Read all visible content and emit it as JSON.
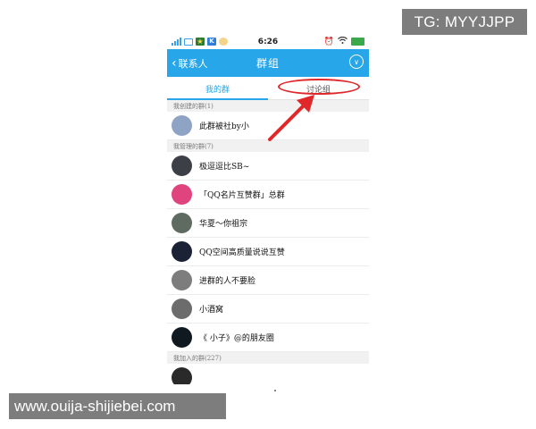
{
  "watermarks": {
    "top": "TG: MYYJJPP",
    "bottom": "www.ouija-shijiebei.com"
  },
  "status_bar": {
    "time": "6:26"
  },
  "title_bar": {
    "back_label": "联系人",
    "title": "群组"
  },
  "tabs": [
    {
      "label": "我的群",
      "active": true
    },
    {
      "label": "讨论组",
      "active": false
    }
  ],
  "sections": {
    "created": "我创建的群(1)",
    "managed": "我管理的群(7)",
    "joined": "我加入的群(227)"
  },
  "groups": {
    "created": [
      {
        "name": "此群被社by小",
        "avatar_color": "#8fa3c4"
      }
    ],
    "managed": [
      {
        "name": "极逗逗比SB~",
        "avatar_color": "#3c3f46"
      },
      {
        "name": "「QQ名片互赞群」总群",
        "avatar_color": "#e0447f"
      },
      {
        "name": "华夏～你祖宗",
        "avatar_color": "#5f6a61"
      },
      {
        "name": "QQ空间高质量说说互赞",
        "avatar_color": "#1c2235"
      },
      {
        "name": "进群的人不要脸",
        "avatar_color": "#7d7d7d"
      },
      {
        "name": "小酒窝",
        "avatar_color": "#6c6c6c"
      },
      {
        "name": "《 小子》@的朋友圈",
        "avatar_color": "#101820"
      }
    ]
  },
  "colors": {
    "accent": "#27a6ea",
    "annotation": "#e0282b",
    "watermark_bg": "#7d7d7d"
  }
}
